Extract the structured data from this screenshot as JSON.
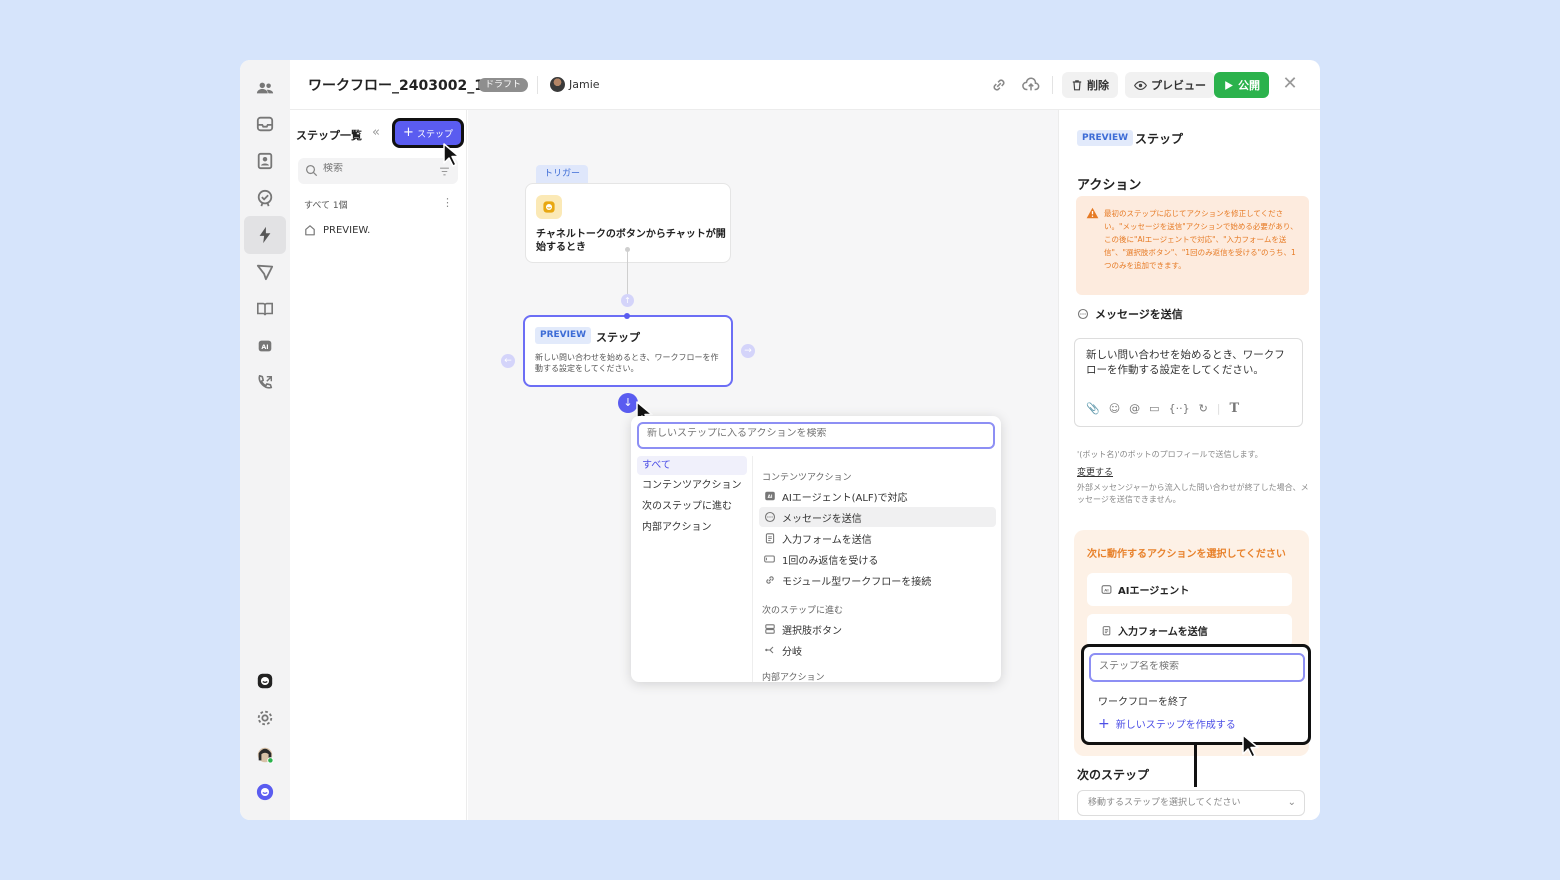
{
  "header": {
    "workflow_title": "ワークフロー_2403002_1",
    "status_badge": "ドラフト",
    "user_name": "Jamie",
    "delete_label": "削除",
    "preview_label": "プレビュー",
    "publish_label": "公開"
  },
  "steps_panel": {
    "title": "ステップ一覧",
    "add_step_label": "ステップ",
    "search_placeholder": "検索",
    "count_label": "すべて 1個",
    "tree_item": "PREVIEW."
  },
  "canvas": {
    "trigger_tag": "トリガー",
    "trigger_text": "チャネルトークのボタンからチャットが開始するとき",
    "preview_badge": "PREVIEW",
    "preview_title": "ステップ",
    "preview_desc": "新しい問い合わせを始めるとき、ワークフローを作動する設定をしてください。"
  },
  "action_popup": {
    "search_placeholder": "新しいステップに入るアクションを検索",
    "categories": [
      "すべて",
      "コンテンツアクション",
      "次のステップに進む",
      "内部アクション"
    ],
    "group_content": "コンテンツアクション",
    "content_items": [
      "AIエージェント(ALF)で対応",
      "メッセージを送信",
      "入力フォームを送信",
      "1回のみ返信を受ける",
      "モジュール型ワークフローを接続"
    ],
    "group_next": "次のステップに進む",
    "next_items": [
      "選択肢ボタン",
      "分岐"
    ],
    "group_internal": "内部アクション"
  },
  "right_panel": {
    "badge": "PREVIEW",
    "title": "ステップ",
    "section_title": "アクション",
    "warning_text": "最初のステップに応じてアクションを修正してください。\"メッセージを送信\"アクションで始める必要があり、この後に\"AIエージェントで対応\"、\"入力フォームを送信\"、\"選択肢ボタン\"、\"1回のみ返信を受ける\"のうち、1つのみを追加できます。",
    "message_label": "メッセージを送信",
    "message_text": "新しい問い合わせを始めるとき、ワークフローを作動する設定をしてください。",
    "note1": "'(ボット名)'のボットのプロフィールで送信します。",
    "change_link": "変更する",
    "note2": "外部メッセンジャーから流入した問い合わせが終了した場合、メッセージを送信できません。",
    "next_action_title": "次に動作するアクションを選択してください",
    "next_action_items": [
      "AIエージェント",
      "入力フォームを送信"
    ],
    "step_search_placeholder": "ステップ名を検索",
    "end_workflow": "ワークフローを終了",
    "new_step": "新しいステップを作成する",
    "next_step_label": "次のステップ",
    "next_step_placeholder": "移動するステップを選択してください"
  },
  "colors": {
    "accent": "#5a5cf0",
    "publish": "#2bb24c",
    "warning": "#e67a24",
    "background": "#d6e4fb"
  }
}
